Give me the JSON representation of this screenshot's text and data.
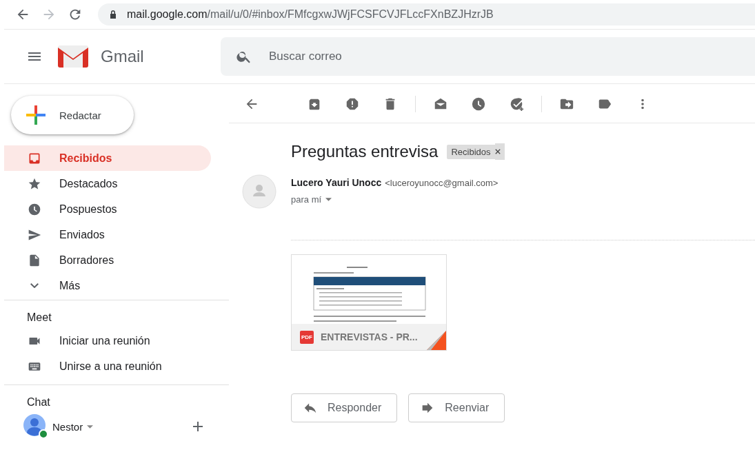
{
  "browser": {
    "url_host": "mail.google.com",
    "url_path": "/mail/u/0/#inbox/FMfcgxwJWjFCSFCVJFLccFXnBZJHzrJB"
  },
  "header": {
    "app_name": "Gmail",
    "search_placeholder": "Buscar correo"
  },
  "compose": {
    "label": "Redactar"
  },
  "nav": [
    {
      "label": "Recibidos",
      "selected": true
    },
    {
      "label": "Destacados",
      "selected": false
    },
    {
      "label": "Pospuestos",
      "selected": false
    },
    {
      "label": "Enviados",
      "selected": false
    },
    {
      "label": "Borradores",
      "selected": false
    },
    {
      "label": "Más",
      "selected": false
    }
  ],
  "meet": {
    "title": "Meet",
    "items": [
      "Iniciar una reunión",
      "Unirse a una reunión"
    ]
  },
  "chat": {
    "title": "Chat",
    "user": "Nestor"
  },
  "message": {
    "subject": "Preguntas entrevisa",
    "label": "Recibidos",
    "sender_name": "Lucero Yauri Unocc",
    "sender_email": "<luceroyunocc@gmail.com>",
    "recipient": "para mí",
    "attachment": {
      "type": "PDF",
      "name": "ENTREVISTAS - PR..."
    },
    "buttons": [
      "Responder",
      "Reenviar"
    ]
  }
}
